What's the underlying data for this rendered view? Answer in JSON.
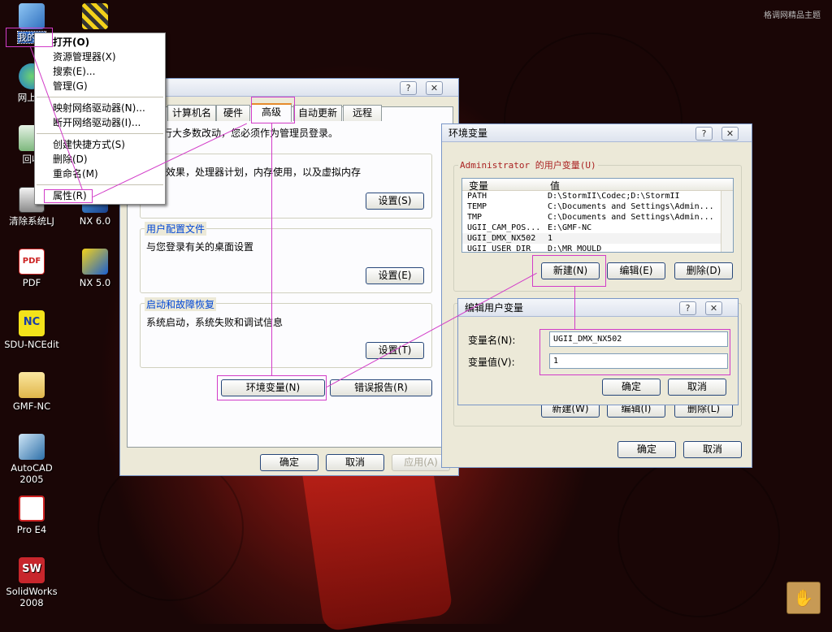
{
  "desktop": {
    "watermark": "格调网精品主题",
    "icons": [
      {
        "label": "我的电",
        "icon": "my-computer-icon"
      },
      {
        "label": "网上邻",
        "icon": "network-icon"
      },
      {
        "label": "回收",
        "icon": "recycle-bin-icon"
      },
      {
        "label": "清除系统LJ",
        "icon": "cleaner-icon"
      },
      {
        "label": "PDF",
        "icon": "pdf-icon"
      },
      {
        "label": "SDU-NCEdit",
        "icon": "nc-edit-icon"
      },
      {
        "label": "GMF-NC",
        "icon": "folder-icon"
      },
      {
        "label": "AutoCAD 2005",
        "icon": "autocad-icon"
      },
      {
        "label": "Pro E4",
        "icon": "proe-icon"
      },
      {
        "label": "SolidWorks 2008",
        "icon": "solidworks-icon"
      },
      {
        "label": "NX 6.0",
        "icon": "nx-icon"
      },
      {
        "label": "NX 5.0",
        "icon": "nx-icon"
      }
    ]
  },
  "context_menu": {
    "items": [
      "打开(O)",
      "资源管理器(X)",
      "搜索(E)...",
      "管理(G)",
      "映射网络驱动器(N)...",
      "断开网络驱动器(I)...",
      "创建快捷方式(S)",
      "删除(D)",
      "重命名(M)",
      "属性(R)"
    ]
  },
  "sysprops": {
    "tabs": [
      "计算机名",
      "硬件",
      "高级",
      "自动更新",
      "远程"
    ],
    "admin_note": "行大多数改动，您必须作为管理员登录。",
    "perf_text": "效果，处理器计划，内存使用，以及虚拟内存",
    "profile_label": "用户配置文件",
    "profile_text": "与您登录有关的桌面设置",
    "startup_label": "启动和故障恢复",
    "startup_text": "系统启动，系统失败和调试信息",
    "settings_btn": "设置(S)",
    "settings_btn2": "设置(E)",
    "settings_btn3": "设置(T)",
    "env_btn": "环境变量(N)",
    "error_btn": "错误报告(R)",
    "ok": "确定",
    "cancel": "取消",
    "apply": "应用(A)"
  },
  "envvars": {
    "title": "环境变量",
    "user_vars_label": "Administrator 的用户变量(U)",
    "columns": [
      "变量",
      "值"
    ],
    "rows": [
      [
        "PATH",
        "D:\\StormII\\Codec;D:\\StormII"
      ],
      [
        "TEMP",
        "C:\\Documents and Settings\\Admin..."
      ],
      [
        "TMP",
        "C:\\Documents and Settings\\Admin..."
      ],
      [
        "UGII_CAM_POS...",
        "E:\\GMF-NC"
      ],
      [
        "UGII_DMX_NX502",
        "1"
      ],
      [
        "UGII_USER_DIR",
        "D:\\MR_MOULD"
      ]
    ],
    "new_btn": "新建(N)",
    "edit_btn": "编辑(E)",
    "delete_btn": "删除(D)",
    "sys_new_btn": "新建(W)",
    "sys_edit_btn": "编辑(I)",
    "sys_delete_btn": "删除(L)",
    "ok": "确定",
    "cancel": "取消"
  },
  "editvar": {
    "title": "编辑用户变量",
    "name_label": "变量名(N):",
    "value_label": "变量值(V):",
    "name_value": "UGII_DMX_NX502",
    "value_value": "1",
    "ok": "确定",
    "cancel": "取消"
  },
  "colors": {
    "highlight": "#d23cc8",
    "selection": "#316ac5",
    "group_label": "#0046d5"
  }
}
